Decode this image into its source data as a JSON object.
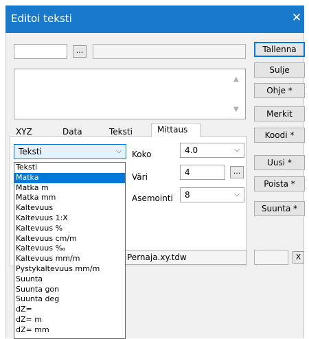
{
  "window": {
    "title": "Editoi teksti",
    "close_glyph": "✕"
  },
  "top_row": {
    "browse_label": "..."
  },
  "right_buttons": [
    {
      "label": "Tallenna"
    },
    {
      "label": "Sulje"
    },
    {
      "label": "Ohje *"
    },
    {
      "label": "Merkit"
    },
    {
      "label": "Koodi *"
    },
    {
      "label": "Uusi *"
    },
    {
      "label": "Poista *"
    },
    {
      "label": "Suunta *"
    }
  ],
  "tabs": [
    {
      "label": "XYZ"
    },
    {
      "label": "Data"
    },
    {
      "label": "Teksti"
    },
    {
      "label": "Mittaus"
    }
  ],
  "mittaus": {
    "type_value": "Teksti",
    "koko_label": "Koko",
    "koko_value": "4.0",
    "vari_label": "Väri",
    "vari_value": "4",
    "vari_browse": "...",
    "asemointi_label": "Asemointi",
    "asemointi_value": "8"
  },
  "dropdown_items": [
    "Teksti",
    "Matka",
    "Matka m",
    "Matka mm",
    "Kaltevuus",
    "Kaltevuus 1:X",
    "Kaltevuus %",
    "Kaltevuus cm/m",
    "Kaltevuus ‰",
    "Kaltevuus mm/m",
    "Pystykaltevuus mm/m",
    "Suunta",
    "Suunta gon",
    "Suunta deg",
    "dZ=",
    "dZ= m",
    "dZ= mm"
  ],
  "dropdown_selected": "Matka",
  "bottom": {
    "file_text": "Pernaja.xy.tdw",
    "x_label": "X"
  },
  "colors": {
    "title_bar": "#1979ca",
    "selection": "#0078d7"
  }
}
